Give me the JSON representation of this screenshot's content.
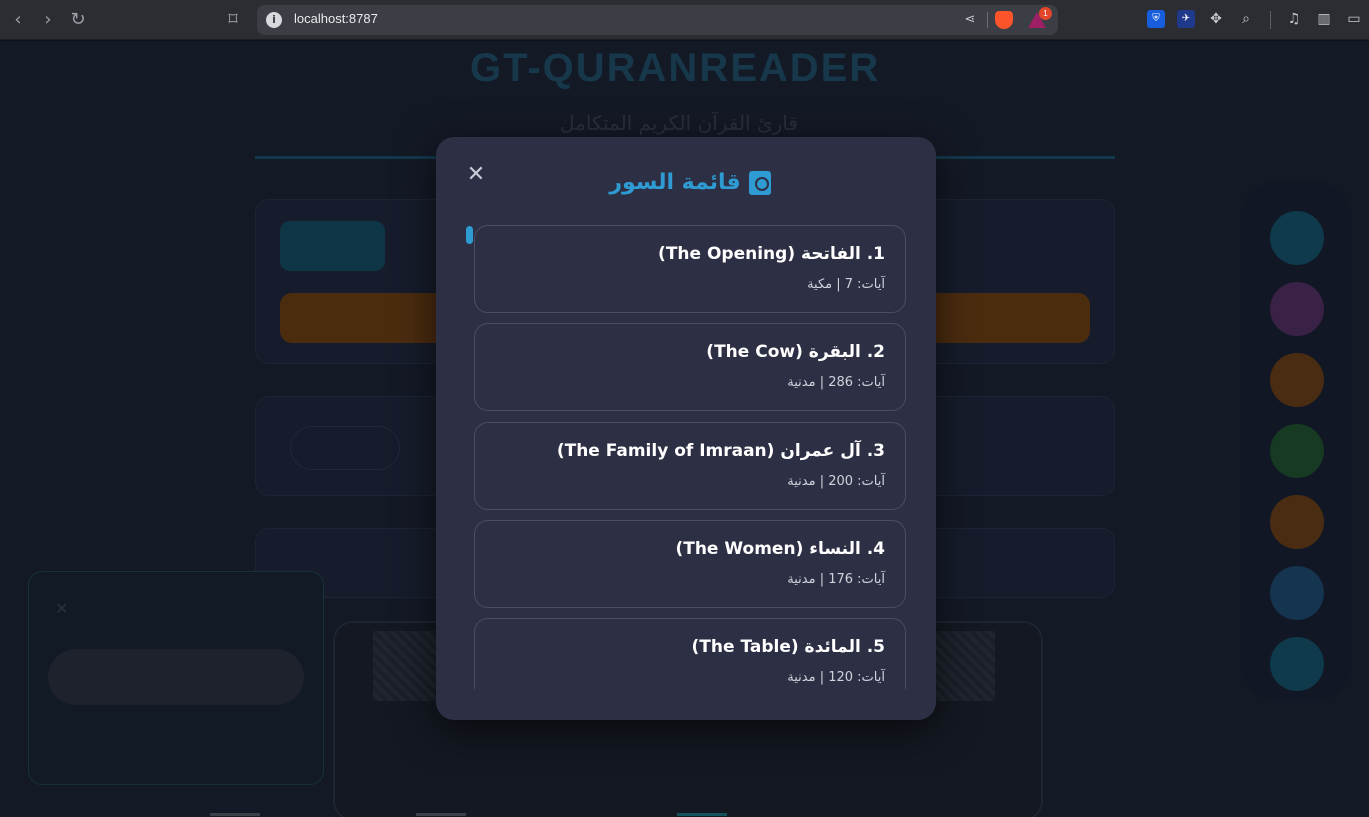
{
  "browser": {
    "url": "localhost:8787",
    "rewards_badge": "1"
  },
  "page": {
    "title": "GT-QURANREADER",
    "subtitle": "قارئ القرآن الكريم المتكامل"
  },
  "modal": {
    "close_label": "✕",
    "title": "قائمة السور",
    "surahs": [
      {
        "name": "1. الفاتحة (The Opening)",
        "meta": "آيات: 7 | مكية"
      },
      {
        "name": "2. البقرة (The Cow)",
        "meta": "آيات: 286 | مدنية"
      },
      {
        "name": "3. آل عمران (The Family of Imraan)",
        "meta": "آيات: 200 | مدنية"
      },
      {
        "name": "4. النساء (The Women)",
        "meta": "آيات: 176 | مدنية"
      },
      {
        "name": "5. المائدة (The Table)",
        "meta": "آيات: 120 | مدنية"
      }
    ]
  },
  "colors": {
    "accent": "#2e9bd3",
    "modal_bg": "#2d2f44",
    "card_border": "#4a4d66"
  },
  "icons": {
    "back": "chevron-left-icon",
    "forward": "chevron-right-icon",
    "reload": "reload-icon",
    "bookmark": "bookmark-icon",
    "site_info": "info-icon",
    "share": "share-icon",
    "brave_shields": "brave-shield-icon",
    "rewards": "rewards-icon",
    "modal_title": "book-icon"
  }
}
